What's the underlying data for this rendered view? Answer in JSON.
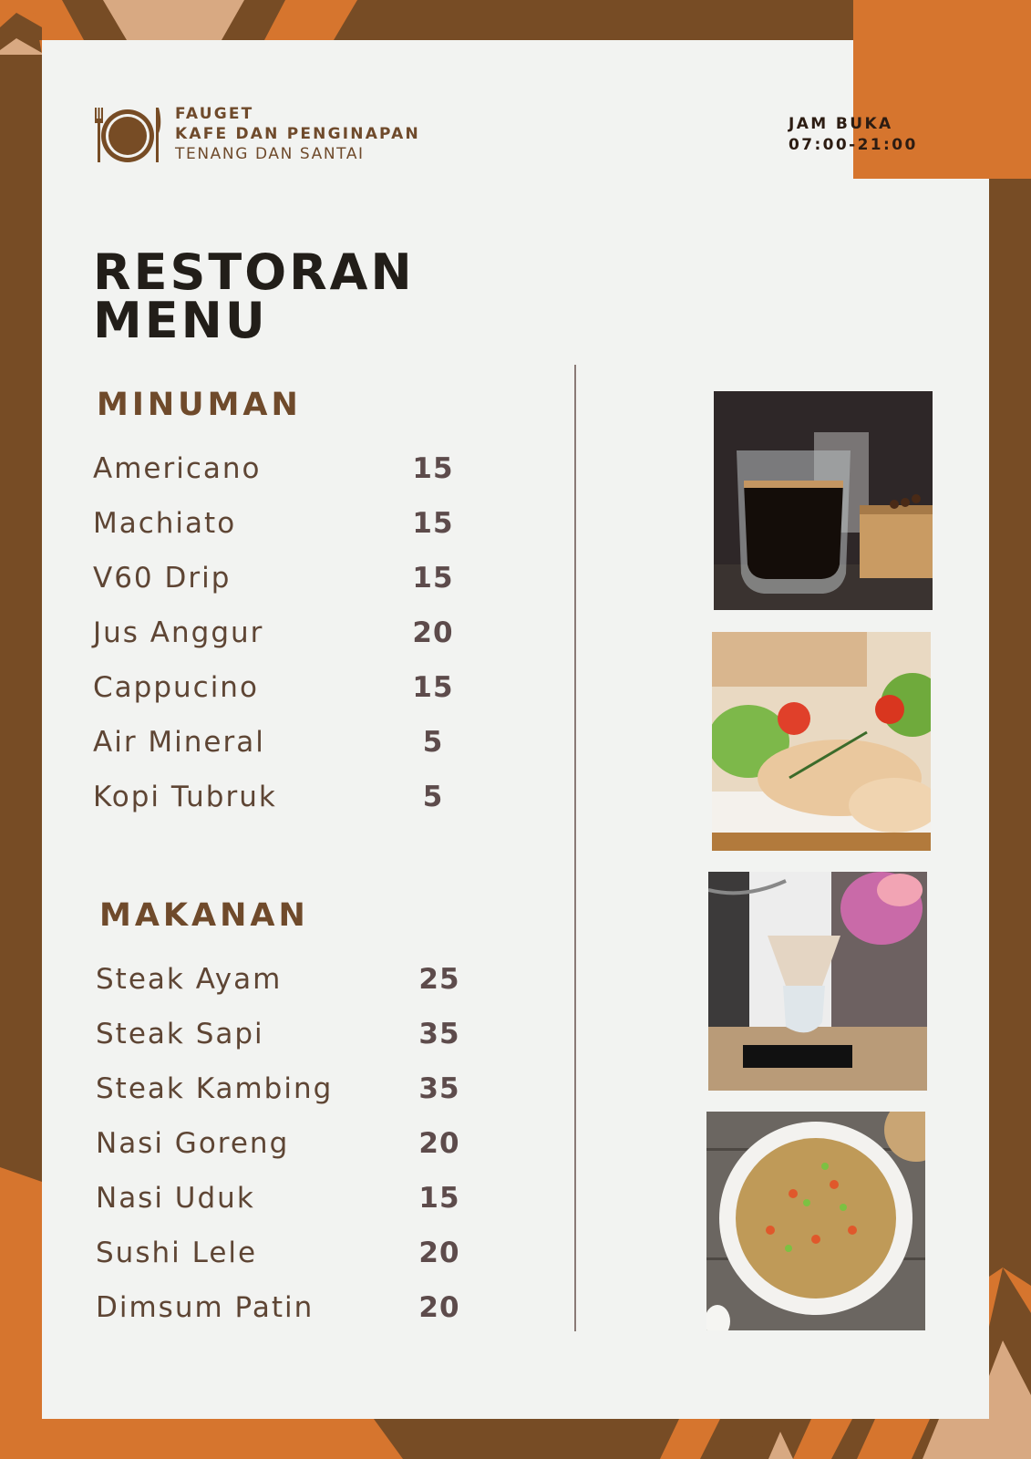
{
  "colors": {
    "brown": "#774C25",
    "orange": "#D6752E",
    "tan": "#D8A982",
    "panel": "#F2F3F1",
    "brand_text": "#6F4A2B",
    "title_text": "#221E19"
  },
  "brand": {
    "icon": "plate-fork-knife-icon",
    "name": "FAUGET",
    "subtitle": "KAFE DAN PENGINAPAN",
    "tagline": "TENANG DAN SANTAI"
  },
  "hours": {
    "label": "JAM BUKA",
    "value": "07:00-21:00"
  },
  "title": {
    "line1": "RESTORAN",
    "line2": "MENU"
  },
  "sections": [
    {
      "title": "MINUMAN",
      "items": [
        {
          "name": "Americano",
          "price": "15"
        },
        {
          "name": "Machiato",
          "price": "15"
        },
        {
          "name": "V60 Drip",
          "price": "15"
        },
        {
          "name": "Jus Anggur",
          "price": "20"
        },
        {
          "name": "Cappucino",
          "price": "15"
        },
        {
          "name": "Air Mineral",
          "price": "5"
        },
        {
          "name": "Kopi Tubruk",
          "price": "5"
        }
      ]
    },
    {
      "title": "MAKANAN",
      "items": [
        {
          "name": "Steak Ayam",
          "price": "25"
        },
        {
          "name": "Steak Sapi",
          "price": "35"
        },
        {
          "name": "Steak Kambing",
          "price": "35"
        },
        {
          "name": "Nasi Goreng",
          "price": "20"
        },
        {
          "name": "Nasi Uduk",
          "price": "15"
        },
        {
          "name": "Sushi Lele",
          "price": "20"
        },
        {
          "name": "Dimsum Patin",
          "price": "20"
        }
      ]
    }
  ],
  "photos": [
    {
      "subject": "black-coffee-glass"
    },
    {
      "subject": "grilled-chicken-salad"
    },
    {
      "subject": "pour-over-coffee"
    },
    {
      "subject": "fried-rice-bowl"
    }
  ]
}
